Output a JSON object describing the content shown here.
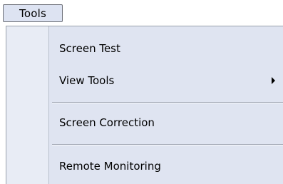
{
  "menubar": {
    "tools_label": "Tools"
  },
  "dropdown": {
    "items": [
      {
        "label": "Screen Test"
      },
      {
        "label": "View Tools",
        "submenu_indicator": "right-arrow-icon"
      },
      {
        "label": "Screen Correction"
      },
      {
        "label": "Remote Monitoring"
      }
    ]
  }
}
